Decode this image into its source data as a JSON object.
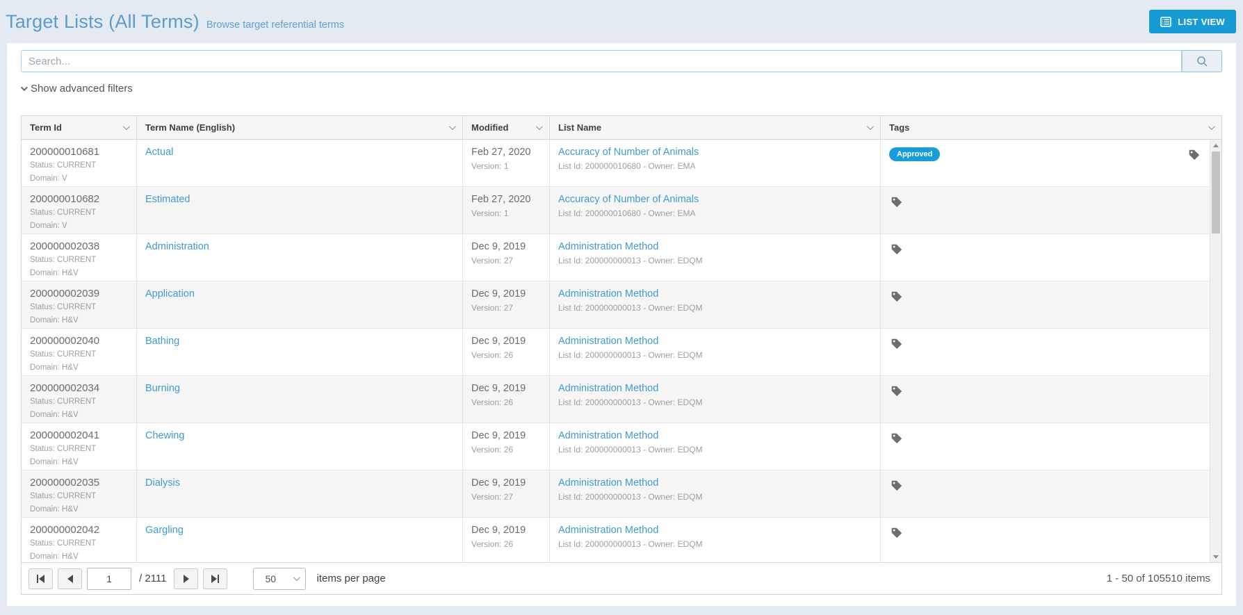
{
  "header": {
    "title": "Target Lists (All Terms)",
    "subtitle": "Browse target referential terms",
    "list_view_button": "LIST VIEW"
  },
  "search": {
    "placeholder": "Search..."
  },
  "filters": {
    "toggle_label": "Show advanced filters"
  },
  "table": {
    "columns": [
      "Term Id",
      "Term Name (English)",
      "Modified",
      "List Name",
      "Tags"
    ],
    "rows": [
      {
        "term_id": "200000010681",
        "status": "Status: CURRENT",
        "domain": "Domain: V",
        "term_name": "Actual",
        "modified": "Feb 27, 2020",
        "version": "Version: 1",
        "list_name": "Accuracy of Number of Animals",
        "list_meta": "List Id: 200000010680 - Owner: EMA",
        "tag": "Approved"
      },
      {
        "term_id": "200000010682",
        "status": "Status: CURRENT",
        "domain": "Domain: V",
        "term_name": "Estimated",
        "modified": "Feb 27, 2020",
        "version": "Version: 1",
        "list_name": "Accuracy of Number of Animals",
        "list_meta": "List Id: 200000010680 - Owner: EMA",
        "tag": ""
      },
      {
        "term_id": "200000002038",
        "status": "Status: CURRENT",
        "domain": "Domain: H&V",
        "term_name": "Administration",
        "modified": "Dec 9, 2019",
        "version": "Version: 27",
        "list_name": "Administration Method",
        "list_meta": "List Id: 200000000013 - Owner: EDQM",
        "tag": ""
      },
      {
        "term_id": "200000002039",
        "status": "Status: CURRENT",
        "domain": "Domain: H&V",
        "term_name": "Application",
        "modified": "Dec 9, 2019",
        "version": "Version: 27",
        "list_name": "Administration Method",
        "list_meta": "List Id: 200000000013 - Owner: EDQM",
        "tag": ""
      },
      {
        "term_id": "200000002040",
        "status": "Status: CURRENT",
        "domain": "Domain: H&V",
        "term_name": "Bathing",
        "modified": "Dec 9, 2019",
        "version": "Version: 26",
        "list_name": "Administration Method",
        "list_meta": "List Id: 200000000013 - Owner: EDQM",
        "tag": ""
      },
      {
        "term_id": "200000002034",
        "status": "Status: CURRENT",
        "domain": "Domain: H&V",
        "term_name": "Burning",
        "modified": "Dec 9, 2019",
        "version": "Version: 26",
        "list_name": "Administration Method",
        "list_meta": "List Id: 200000000013 - Owner: EDQM",
        "tag": ""
      },
      {
        "term_id": "200000002041",
        "status": "Status: CURRENT",
        "domain": "Domain: H&V",
        "term_name": "Chewing",
        "modified": "Dec 9, 2019",
        "version": "Version: 26",
        "list_name": "Administration Method",
        "list_meta": "List Id: 200000000013 - Owner: EDQM",
        "tag": ""
      },
      {
        "term_id": "200000002035",
        "status": "Status: CURRENT",
        "domain": "Domain: H&V",
        "term_name": "Dialysis",
        "modified": "Dec 9, 2019",
        "version": "Version: 27",
        "list_name": "Administration Method",
        "list_meta": "List Id: 200000000013 - Owner: EDQM",
        "tag": ""
      },
      {
        "term_id": "200000002042",
        "status": "Status: CURRENT",
        "domain": "Domain: H&V",
        "term_name": "Gargling",
        "modified": "Dec 9, 2019",
        "version": "Version: 26",
        "list_name": "Administration Method",
        "list_meta": "List Id: 200000000013 - Owner: EDQM",
        "tag": ""
      }
    ]
  },
  "pagination": {
    "page_value": "1",
    "total_pages": "/ 2111",
    "page_size": "50",
    "page_size_suffix": "items per page",
    "range_text": "1 - 50 of 105510 items"
  },
  "colors": {
    "accent_blue": "#189bd5",
    "link_blue": "#3f9ad3",
    "badge_blue": "#1a9cd8",
    "page_background": "#e3eaf2",
    "title_blue": "#5b9ccb"
  }
}
